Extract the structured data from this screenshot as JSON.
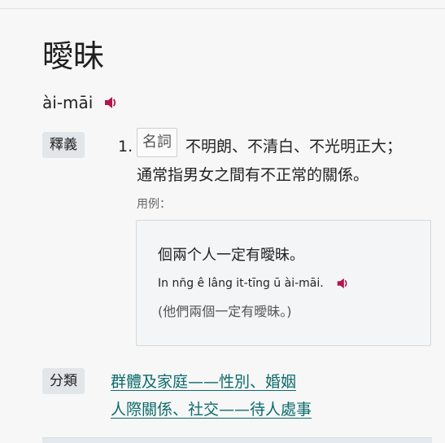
{
  "entry": {
    "headword": "曖昧",
    "pronunciation": "ài-māi"
  },
  "sections": {
    "definition_label": "釋義",
    "category_label": "分類"
  },
  "definition": {
    "number": "1.",
    "part_of_speech": "名詞",
    "text_line1": "不明朗、不清白、不光明正大；",
    "text_line2": "通常指男女之間有不正常的關係。",
    "example_label": "用例："
  },
  "example": {
    "hanzi": "佪兩个人一定有曖昧。",
    "romanization": "In nn̄g ê lâng it-tīng ū ài-māi.",
    "translation": "(他們兩個一定有曖昧。)"
  },
  "categories": [
    "群體及家庭——性別、婚姻",
    "人際關係、社交——待人處事"
  ],
  "colors": {
    "speaker": "#b0174a",
    "link": "#0d6b6b",
    "tag_bg": "#e2e6e9"
  },
  "icons": {
    "audio": "speaker-icon"
  }
}
